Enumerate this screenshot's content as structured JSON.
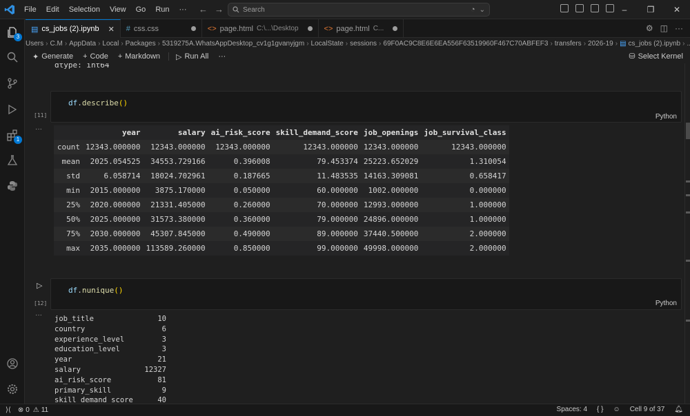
{
  "menu": [
    "File",
    "Edit",
    "Selection",
    "View",
    "Go",
    "Run",
    "···"
  ],
  "search": {
    "text": "Search"
  },
  "tabs": [
    {
      "label": "cs_jobs (2).ipynb",
      "desc": "",
      "active": true
    },
    {
      "label": "css.css",
      "desc": ""
    },
    {
      "label": "page.html",
      "desc": "C:\\...\\Desktop"
    },
    {
      "label": "page.html",
      "desc": "C..."
    }
  ],
  "breadcrumb": [
    "Users",
    "C.M",
    "AppData",
    "Local",
    "Packages",
    "5319275A.WhatsAppDesktop_cv1g1gvanyjgm",
    "LocalState",
    "sessions",
    "69F0AC9C8E6E6EA556F63519960F467C70ABFEF3",
    "transfers",
    "2026-19",
    "cs_jobs (2).ipynb",
    "..."
  ],
  "toolbar": {
    "generate": "Generate",
    "code": "Code",
    "markdown": "Markdown",
    "run_all": "Run All",
    "more": "···",
    "kernel": "Select Kernel"
  },
  "prev_output": "dtype: int64",
  "cells": [
    {
      "exec": "[11]",
      "var": "df",
      "method": "describe",
      "lang": "Python"
    },
    {
      "exec": "[12]",
      "var": "df",
      "method": "nunique",
      "lang": "Python"
    }
  ],
  "describe": {
    "columns": [
      "",
      "year",
      "salary",
      "ai_risk_score",
      "skill_demand_score",
      "job_openings",
      "job_survival_class"
    ],
    "rows": [
      [
        "count",
        "12343.000000",
        "12343.000000",
        "12343.000000",
        "12343.000000",
        "12343.000000",
        "12343.000000"
      ],
      [
        "mean",
        "2025.054525",
        "34553.729166",
        "0.396008",
        "79.453374",
        "25223.652029",
        "1.310054"
      ],
      [
        "std",
        "6.058714",
        "18024.702961",
        "0.187665",
        "11.483535",
        "14163.309081",
        "0.658417"
      ],
      [
        "min",
        "2015.000000",
        "3875.170000",
        "0.050000",
        "60.000000",
        "1002.000000",
        "0.000000"
      ],
      [
        "25%",
        "2020.000000",
        "21331.405000",
        "0.260000",
        "70.000000",
        "12993.000000",
        "1.000000"
      ],
      [
        "50%",
        "2025.000000",
        "31573.380000",
        "0.360000",
        "79.000000",
        "24896.000000",
        "1.000000"
      ],
      [
        "75%",
        "2030.000000",
        "45307.845000",
        "0.490000",
        "89.000000",
        "37440.500000",
        "2.000000"
      ],
      [
        "max",
        "2035.000000",
        "113589.260000",
        "0.850000",
        "99.000000",
        "49998.000000",
        "2.000000"
      ]
    ]
  },
  "nunique": [
    [
      "job_title",
      "10"
    ],
    [
      "country",
      "6"
    ],
    [
      "experience_level",
      "3"
    ],
    [
      "education_level",
      "3"
    ],
    [
      "year",
      "21"
    ],
    [
      "salary",
      "12327"
    ],
    [
      "ai_risk_score",
      "81"
    ],
    [
      "primary_skill",
      "9"
    ],
    [
      "skill_demand_score",
      "40"
    ]
  ],
  "status": {
    "errors": "0",
    "warnings": "11",
    "spaces": "Spaces: 4",
    "braces": "{ }",
    "cell": "Cell 9 of 37"
  },
  "activity_badges": {
    "explorer": "3",
    "extensions": "1"
  },
  "colors": {
    "accent": "#0078d4",
    "bg": "#1f1f1f"
  }
}
